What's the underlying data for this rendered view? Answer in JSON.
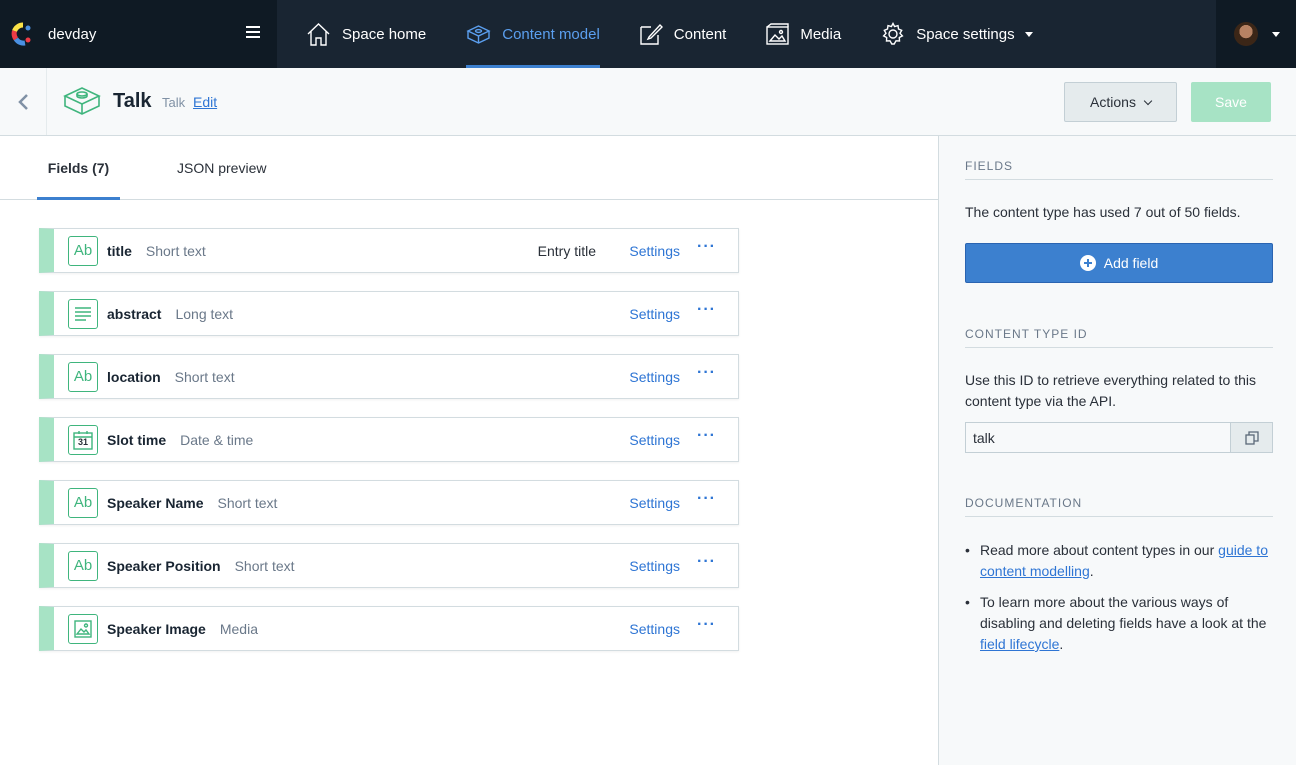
{
  "topnav": {
    "space_name": "devday",
    "items": [
      {
        "label": "Space home",
        "icon": "home-icon"
      },
      {
        "label": "Content model",
        "icon": "content-model-icon"
      },
      {
        "label": "Content",
        "icon": "content-icon"
      },
      {
        "label": "Media",
        "icon": "media-icon"
      },
      {
        "label": "Space settings",
        "icon": "gear-icon"
      }
    ],
    "active": "Content model",
    "colors": {
      "bar": "#192532",
      "active": "#5b9fef"
    }
  },
  "header": {
    "title": "Talk",
    "subtitle": "Talk",
    "edit_label": "Edit",
    "actions_label": "Actions",
    "save_label": "Save"
  },
  "tabs": {
    "fields_label": "Fields (7)",
    "json_label": "JSON preview"
  },
  "fields": [
    {
      "name": "title",
      "type": "Short text",
      "icon": "text-icon",
      "entry_title": "Entry title",
      "settings": "Settings"
    },
    {
      "name": "abstract",
      "type": "Long text",
      "icon": "long-text-icon",
      "settings": "Settings"
    },
    {
      "name": "location",
      "type": "Short text",
      "icon": "text-icon",
      "settings": "Settings"
    },
    {
      "name": "Slot time",
      "type": "Date & time",
      "icon": "calendar-icon",
      "settings": "Settings"
    },
    {
      "name": "Speaker Name",
      "type": "Short text",
      "icon": "text-icon",
      "settings": "Settings"
    },
    {
      "name": "Speaker Position",
      "type": "Short text",
      "icon": "text-icon",
      "settings": "Settings"
    },
    {
      "name": "Speaker Image",
      "type": "Media",
      "icon": "media-icon",
      "settings": "Settings"
    }
  ],
  "icon_glyphs": {
    "ab": "Ab",
    "calendar_day": "31"
  },
  "sidebar": {
    "fields_heading": "FIELDS",
    "fields_text": "The content type has used 7 out of 50 fields.",
    "add_field_label": "Add field",
    "ctid_heading": "CONTENT TYPE ID",
    "ctid_text": "Use this ID to retrieve everything related to this content type via the API.",
    "ctid_value": "talk",
    "doc_heading": "DOCUMENTATION",
    "doc_item1_pre": "Read more about content types in our ",
    "doc_item1_link": "guide to content modelling",
    "doc_item1_post": ".",
    "doc_item2_pre": "To learn more about the various ways of disabling and deleting fields have a look at the ",
    "doc_item2_link": "field lifecycle",
    "doc_item2_post": "."
  }
}
